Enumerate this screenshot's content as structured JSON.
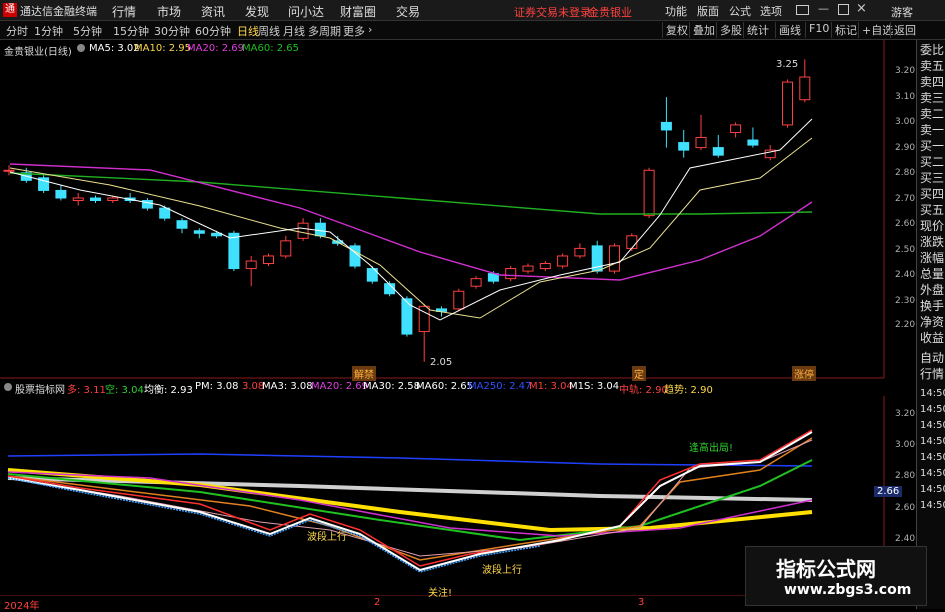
{
  "titlebar": {
    "logo": "通",
    "app_name": "通达信金融终端",
    "menus": [
      "行情",
      "市场",
      "资讯",
      "发现",
      "问小达",
      "财富圈",
      "交易"
    ],
    "status": "证券交易未登录",
    "stock": "金贵银业",
    "right_menus": [
      "功能",
      "版面",
      "公式",
      "选项"
    ],
    "guest": "游客"
  },
  "toolbar": {
    "periods": [
      "分时",
      "1分钟",
      "5分钟",
      "15分钟",
      "30分钟",
      "60分钟",
      "日线",
      "周线",
      "月线",
      "多周期",
      "更多"
    ],
    "active_period": "日线",
    "right_buttons": [
      "复权",
      "叠加",
      "多股",
      "统计",
      "画线",
      "F10",
      "标记",
      "+自选",
      "返回"
    ]
  },
  "main_chart": {
    "title": "金贵银业(日线)",
    "ma": [
      {
        "label": "MA5: 3.02",
        "color": "#ffffff"
      },
      {
        "label": "MA10: 2.95",
        "color": "#ffd84a"
      },
      {
        "label": "MA20: 2.69",
        "color": "#e040e0"
      },
      {
        "label": "MA60: 2.65",
        "color": "#20c020"
      }
    ],
    "y_ticks": [
      "3.20",
      "3.10",
      "3.00",
      "2.90",
      "2.80",
      "2.70",
      "2.60",
      "2.50",
      "2.40",
      "2.30",
      "2.20"
    ],
    "high_label": "3.25",
    "low_label": "2.05",
    "event_labels": [
      "解禁",
      "定",
      "涨停"
    ]
  },
  "indicator": {
    "title": "股票指标网",
    "items": [
      {
        "t": "多: 3.11",
        "c": "#ff4040"
      },
      {
        "t": "空: 3.04",
        "c": "#30d030"
      },
      {
        "t": "均衡: 2.93",
        "c": "#ffffff"
      },
      {
        "t": "PM: 3.08",
        "c": "#ffffff"
      },
      {
        "t": "3.08",
        "c": "#ff4040"
      },
      {
        "t": "MA3: 3.08",
        "c": "#ffffff"
      },
      {
        "t": "MA20: 2.69",
        "c": "#e040e0"
      },
      {
        "t": "MA30: 2.58",
        "c": "#ffffff"
      },
      {
        "t": "MA60: 2.65",
        "c": "#ffffff"
      },
      {
        "t": "MA250: 2.47",
        "c": "#3050ff"
      },
      {
        "t": "M1: 3.04",
        "c": "#ff4040"
      },
      {
        "t": "M1S: 3.04",
        "c": "#ffffff"
      },
      {
        "t": "中轨: 2.90",
        "c": "#ff4040"
      },
      {
        "t": "趋势: 2.90",
        "c": "#ffd84a"
      }
    ],
    "y_ticks": [
      "3.20",
      "3.00",
      "2.80",
      "2.60",
      "2.40"
    ],
    "current": "2.66",
    "annotations": [
      "波段上行",
      "波段上行",
      "逢高出局!",
      "关注!"
    ]
  },
  "right_sidebar": {
    "items": [
      "委比",
      "卖五",
      "卖四",
      "卖三",
      "卖二",
      "卖一",
      "买一",
      "买二",
      "买三",
      "买四",
      "买五",
      "现价",
      "涨跌",
      "涨幅",
      "总量",
      "外盘",
      "换手",
      "净资",
      "收益",
      "自动",
      "行情"
    ],
    "values": [
      "14:50",
      "14:50",
      "14:50",
      "14:50",
      "14:50",
      "14:50",
      "14:50",
      "14:50"
    ]
  },
  "timeline": [
    "2024年",
    "2",
    "3"
  ],
  "watermark": {
    "title": "指标公式网",
    "url": "www.zbgs3.com"
  }
}
